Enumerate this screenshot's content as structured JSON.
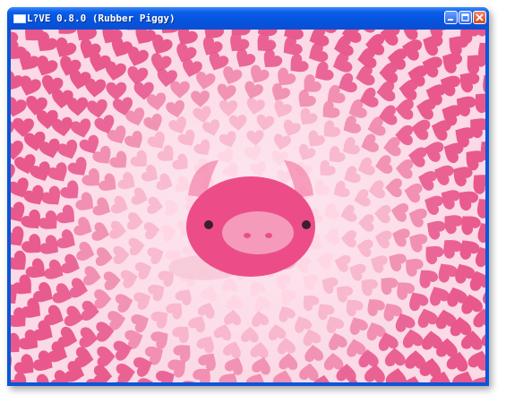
{
  "window": {
    "title": "L?VE 0.8.0 (Rubber Piggy)"
  },
  "controls": [
    {
      "name": "minimize",
      "icon": "minimize-icon"
    },
    {
      "name": "maximize",
      "icon": "maximize-icon"
    },
    {
      "name": "close",
      "icon": "close-icon"
    }
  ],
  "scene": {
    "background_color": "#fbd9e6",
    "heart_colors": [
      "#ffd0e0",
      "#f6a9c4",
      "#ee82a8",
      "#e8588d"
    ],
    "pig_color": "#ec4d88",
    "snout_color": "#f59abb",
    "ear_color": "#f27aa3"
  }
}
